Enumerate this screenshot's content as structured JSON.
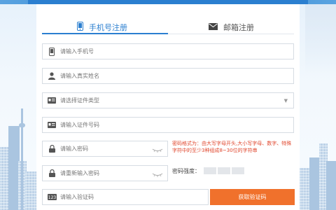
{
  "tabs": {
    "phone_label": "手机号注册",
    "email_label": "邮箱注册"
  },
  "form": {
    "phone_placeholder": "请输入手机号",
    "name_placeholder": "请输入真实姓名",
    "id_type_placeholder": "请选择证件类型",
    "id_number_placeholder": "请输入证件号码",
    "password_placeholder": "请输入密码",
    "password_confirm_placeholder": "请重新输入密码",
    "code_placeholder": "请输入验证码"
  },
  "password_hint": "密码格式为：由大写字母开头,大小写字母、数字、特殊字符中的至少3种组成8~30位的字符串",
  "strength_label": "密码强度：",
  "get_code_label": "获取验证码",
  "colors": {
    "accent": "#2b7fd0",
    "button": "#f0712c",
    "hint": "#e0462c"
  }
}
